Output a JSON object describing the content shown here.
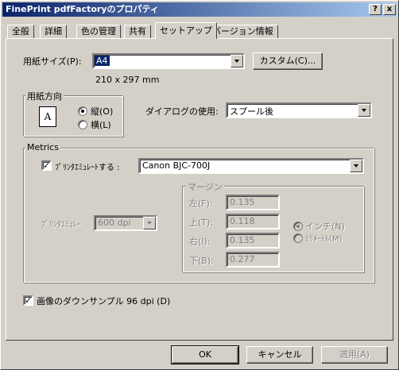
{
  "window": {
    "title": "FinePrint pdfFactoryのプロパティ",
    "help_button": "?",
    "close_button": "x"
  },
  "tabs": [
    {
      "label": "全般"
    },
    {
      "label": "詳細"
    },
    {
      "label": "色の管理"
    },
    {
      "label": "共有"
    },
    {
      "label": "セットアップ"
    },
    {
      "label": "バージョン情報"
    }
  ],
  "active_tab": "セットアップ",
  "paper": {
    "label": "用紙サイズ(P):",
    "value": "A4",
    "dimensions": "210 x 297 mm",
    "custom_button": "カスタム(C)..."
  },
  "orientation": {
    "group_label": "用紙方向",
    "icon_letter": "A",
    "portrait_label": "縦(O)",
    "landscape_label": "横(L)",
    "selected": "portrait"
  },
  "dialog_usage": {
    "label": "ダイアログの使用:",
    "value": "スプール後"
  },
  "metrics": {
    "group_label": "Metrics",
    "emulate_checkbox_label": "ﾌﾟﾘﾝﾀｴﾐｭﾚｰﾄする :",
    "emulate_checked": true,
    "printer_value": "Canon BJC-700J",
    "emulator_label": "ﾌﾟﾘﾝﾀｴﾐｭﾚｰ",
    "resolution_value": "600 dpi",
    "margin": {
      "group_label": "マージン",
      "left_label": "左(F):",
      "left_value": "0.135",
      "top_label": "上(T):",
      "top_value": "0.118",
      "right_label": "右(I):",
      "right_value": "0.135",
      "bottom_label": "下(B):",
      "bottom_value": "0.277",
      "inch_label": "インチ(N)",
      "mm_label": "ﾐﾘﾒｰﾄﾙ(M)",
      "unit_selected": "inch"
    }
  },
  "downsample": {
    "label": "画像のダウンサンプル 96 dpi (D)",
    "checked": true
  },
  "footer": {
    "ok": "OK",
    "cancel": "キャンセル",
    "apply": "適用(A)"
  },
  "colors": {
    "title_gradient_start": "#0a246a",
    "title_gradient_end": "#a6caf0",
    "face": "#d4d0c8",
    "disabled_text": "#808080"
  }
}
